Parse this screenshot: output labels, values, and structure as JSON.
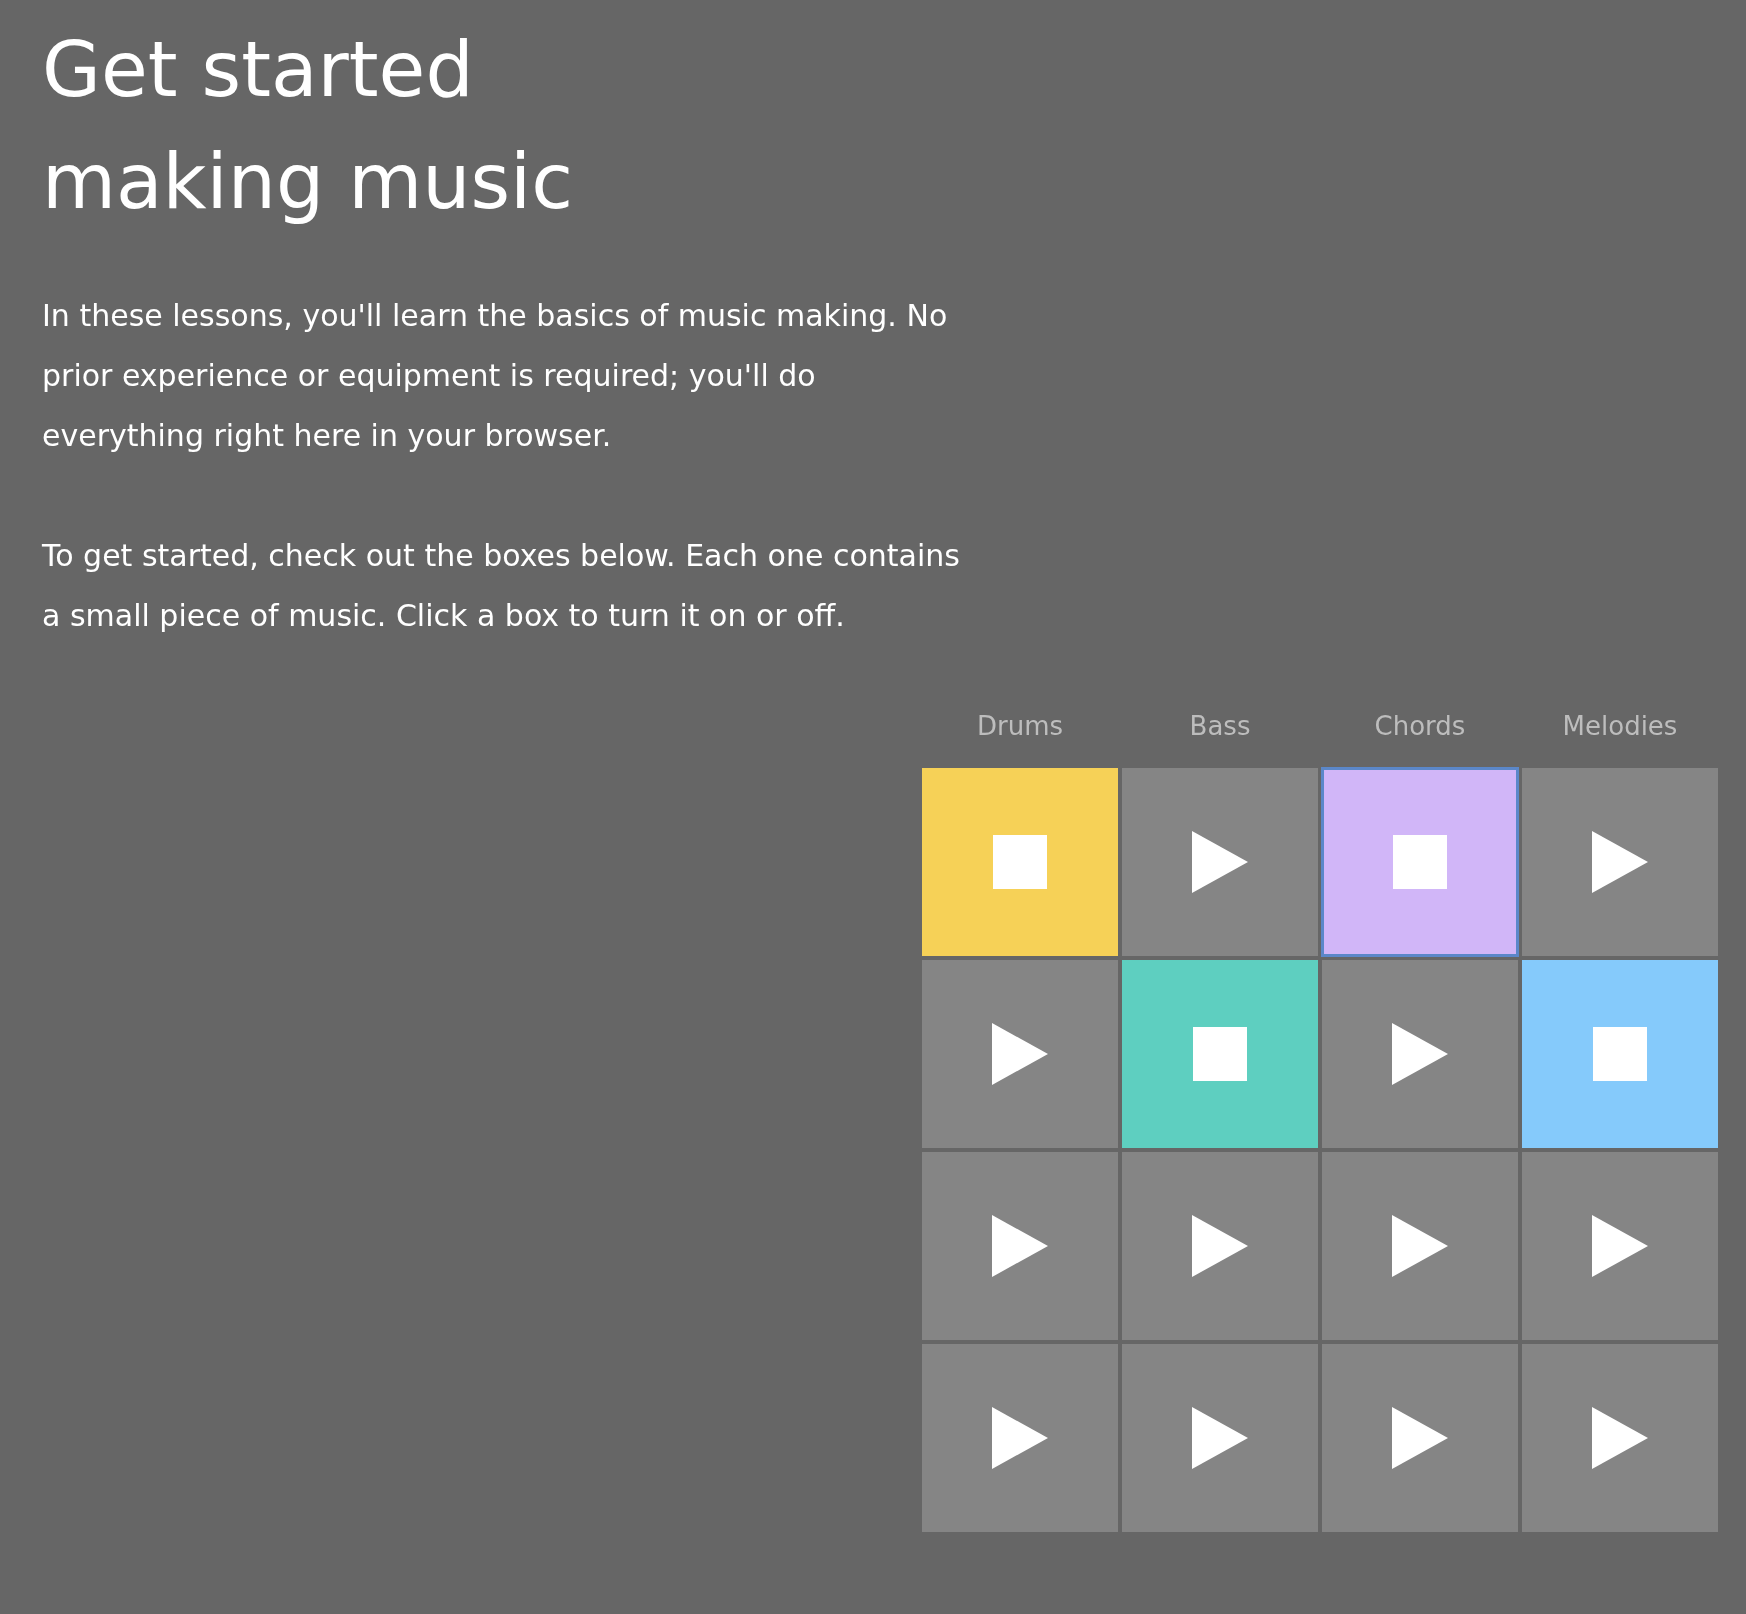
{
  "title_lines": [
    "Get started",
    "making music"
  ],
  "paragraphs": [
    "In these lessons, you'll learn the basics of music making. No prior experience or equipment is required; you'll do everything right here in your browser.",
    "To get started, check out the boxes below. Each one contains a small piece of music. Click a box to turn it on or off."
  ],
  "columns": [
    {
      "label": "Drums",
      "color": "#f6d157"
    },
    {
      "label": "Bass",
      "color": "#5ecfc0"
    },
    {
      "label": "Chords",
      "color": "#d1b6f8"
    },
    {
      "label": "Melodies",
      "color": "#85cafb"
    }
  ],
  "rows": [
    [
      {
        "active": true,
        "focused": false
      },
      {
        "active": false,
        "focused": false
      },
      {
        "active": true,
        "focused": true
      },
      {
        "active": false,
        "focused": false
      }
    ],
    [
      {
        "active": false,
        "focused": false
      },
      {
        "active": true,
        "focused": false
      },
      {
        "active": false,
        "focused": false
      },
      {
        "active": true,
        "focused": false
      }
    ],
    [
      {
        "active": false,
        "focused": false
      },
      {
        "active": false,
        "focused": false
      },
      {
        "active": false,
        "focused": false
      },
      {
        "active": false,
        "focused": false
      }
    ],
    [
      {
        "active": false,
        "focused": false
      },
      {
        "active": false,
        "focused": false
      },
      {
        "active": false,
        "focused": false
      },
      {
        "active": false,
        "focused": false
      }
    ]
  ]
}
